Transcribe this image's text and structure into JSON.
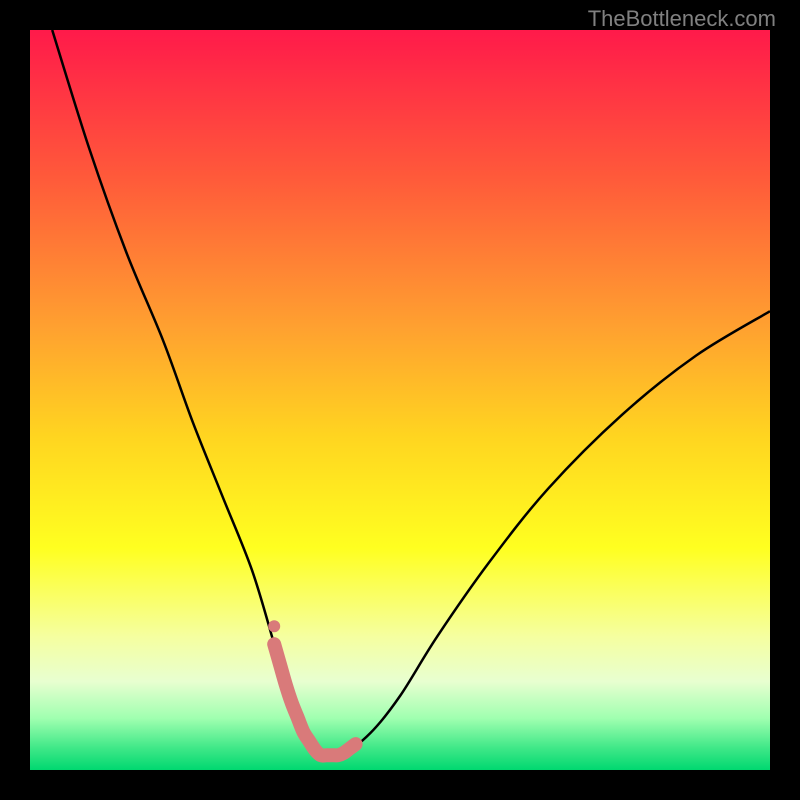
{
  "watermark": "TheBottleneck.com",
  "chart_data": {
    "type": "line",
    "title": "",
    "xlabel": "",
    "ylabel": "",
    "xlim": [
      0,
      100
    ],
    "ylim": [
      0,
      100
    ],
    "gradient_stops": [
      {
        "offset": 0,
        "color": "#ff1a4a"
      },
      {
        "offset": 20,
        "color": "#ff5a3a"
      },
      {
        "offset": 40,
        "color": "#ffa030"
      },
      {
        "offset": 55,
        "color": "#ffd520"
      },
      {
        "offset": 70,
        "color": "#ffff20"
      },
      {
        "offset": 82,
        "color": "#f5ffa0"
      },
      {
        "offset": 88,
        "color": "#e8ffd0"
      },
      {
        "offset": 93,
        "color": "#a0ffb0"
      },
      {
        "offset": 97,
        "color": "#40e888"
      },
      {
        "offset": 100,
        "color": "#00d870"
      }
    ],
    "series": [
      {
        "name": "bottleneck-curve",
        "color": "#000000",
        "x": [
          3,
          8,
          13,
          18,
          22,
          26,
          30,
          33,
          35,
          37,
          39,
          42,
          46,
          50,
          55,
          62,
          70,
          80,
          90,
          100
        ],
        "y": [
          100,
          84,
          70,
          58,
          47,
          37,
          27,
          17,
          10,
          5,
          2,
          2,
          5,
          10,
          18,
          28,
          38,
          48,
          56,
          62
        ]
      }
    ],
    "highlight_band": {
      "name": "optimal-range",
      "color": "#d97a7a",
      "x_start": 33,
      "x_end": 44,
      "y_base": 2,
      "thickness": 4
    }
  }
}
